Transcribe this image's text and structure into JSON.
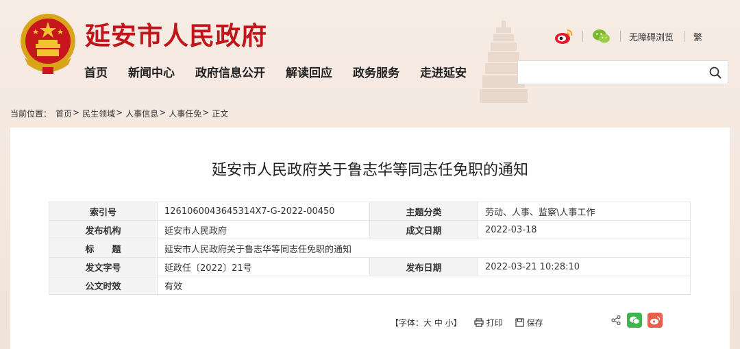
{
  "header": {
    "site_title": "延安市人民政府",
    "emblem_icon": "national-emblem-icon",
    "nav": [
      "首页",
      "新闻中心",
      "政府信息公开",
      "解读回应",
      "政务服务",
      "走进延安"
    ],
    "tools": {
      "weibo_icon": "weibo-icon",
      "wechat_icon": "wechat-icon",
      "accessible": "无障碍浏览",
      "traditional": "繁"
    },
    "search": {
      "value": "",
      "placeholder": "",
      "icon": "search-icon"
    }
  },
  "breadcrumb": {
    "label": "当前位置：",
    "items": [
      "首页",
      "民生领域",
      "人事信息",
      "人事任免",
      "正文"
    ],
    "separator": ">"
  },
  "article": {
    "title": "延安市人民政府关于鲁志华等同志任免职的通知",
    "meta": {
      "index_label": "索引号",
      "index_value": "1261060043645314X7-G-2022-00450",
      "topic_label": "主题分类",
      "topic_value": "劳动、人事、监察\\人事工作",
      "org_label": "发布机构",
      "org_value": "延安市人民政府",
      "date_label": "成文日期",
      "date_value": "2022-03-18",
      "title_label": "标　　题",
      "title_value": "延安市人民政府关于鲁志华等同志任免职的通知",
      "doc_no_label": "发文字号",
      "doc_no_value": "延政任〔2022〕21号",
      "pub_label": "发布日期",
      "pub_value": "2022-03-21 10:28:10",
      "valid_label": "公文时效",
      "valid_value": "有效"
    }
  },
  "footer_tools": {
    "font": "【字体：大 中 小】",
    "print": "打印",
    "save": "保存",
    "share_icon": "share-icon",
    "colors": {
      "wechat": "#3fb34f",
      "weibo": "#e8604c"
    }
  }
}
